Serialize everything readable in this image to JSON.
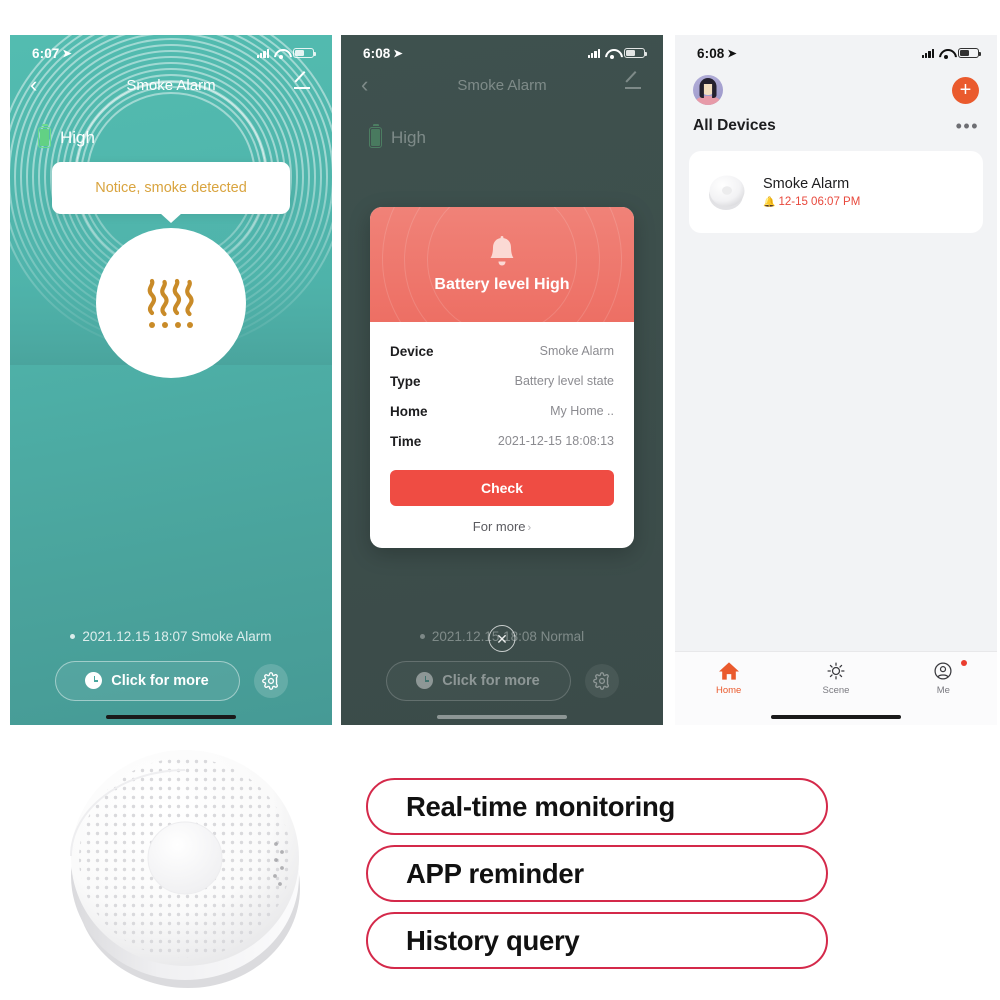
{
  "phone1": {
    "status": {
      "time": "6:07",
      "location_icon": "location-arrow-icon",
      "signal_icon": "signal-bars-icon",
      "wifi_icon": "wifi-icon",
      "battery_icon": "battery-icon"
    },
    "nav": {
      "back_icon": "chevron-left-icon",
      "title": "Smoke Alarm",
      "edit_icon": "pencil-edit-icon"
    },
    "battery": {
      "icon": "battery-level-icon",
      "label": "High"
    },
    "tooltip": "Notice, smoke detected",
    "center_icon": "smoke-waves-icon",
    "log": "2021.12.15 18:07 Smoke Alarm",
    "click_more": "Click for more",
    "clock_icon": "clock-icon",
    "gear_icon": "gear-icon"
  },
  "phone2": {
    "status": {
      "time": "6:08"
    },
    "nav": {
      "title": "Smoke Alarm"
    },
    "battery": {
      "label": "High"
    },
    "modal": {
      "head_icon": "bell-icon",
      "head_title": "Battery level High",
      "rows": [
        {
          "key": "Device",
          "value": "Smoke Alarm"
        },
        {
          "key": "Type",
          "value": "Battery level state"
        },
        {
          "key": "Home",
          "value": "My Home .."
        },
        {
          "key": "Time",
          "value": "2021-12-15 18:08:13"
        }
      ],
      "check_label": "Check",
      "for_more": "For more",
      "for_more_chevron": "chevron-right-icon"
    },
    "close_icon": "close-x-icon",
    "log": "2021.12.15 18:08 Normal",
    "click_more": "Click for more"
  },
  "phone3": {
    "status": {
      "time": "6:08"
    },
    "avatar_icon": "user-avatar-icon",
    "add_icon": "plus-add-device-icon",
    "section_title": "All Devices",
    "more_icon": "ellipsis-more-icon",
    "devices": [
      {
        "thumb_icon": "smoke-detector-icon",
        "name": "Smoke Alarm",
        "alarm_icon": "bell-alert-icon",
        "alarm_time": "12-15 06:07 PM"
      }
    ],
    "tabs": [
      {
        "icon": "home-icon",
        "label": "Home",
        "active": true,
        "badge": false
      },
      {
        "icon": "sun-scene-icon",
        "label": "Scene",
        "active": false,
        "badge": false
      },
      {
        "icon": "me-profile-icon",
        "label": "Me",
        "active": false,
        "badge": true
      }
    ]
  },
  "product": {
    "icon": "smoke-detector-product-photo"
  },
  "features": [
    "Real-time monitoring",
    "APP reminder",
    "History query"
  ],
  "colors": {
    "teal": "#4fb4ab",
    "teal_dark": "#3e514e",
    "salmon": "#ed6f64",
    "red": "#ef4c43",
    "orange": "#ea5a2d",
    "crimson_border": "#d4294a",
    "amber_text": "#d9a43f",
    "green_battery": "#62d184"
  }
}
